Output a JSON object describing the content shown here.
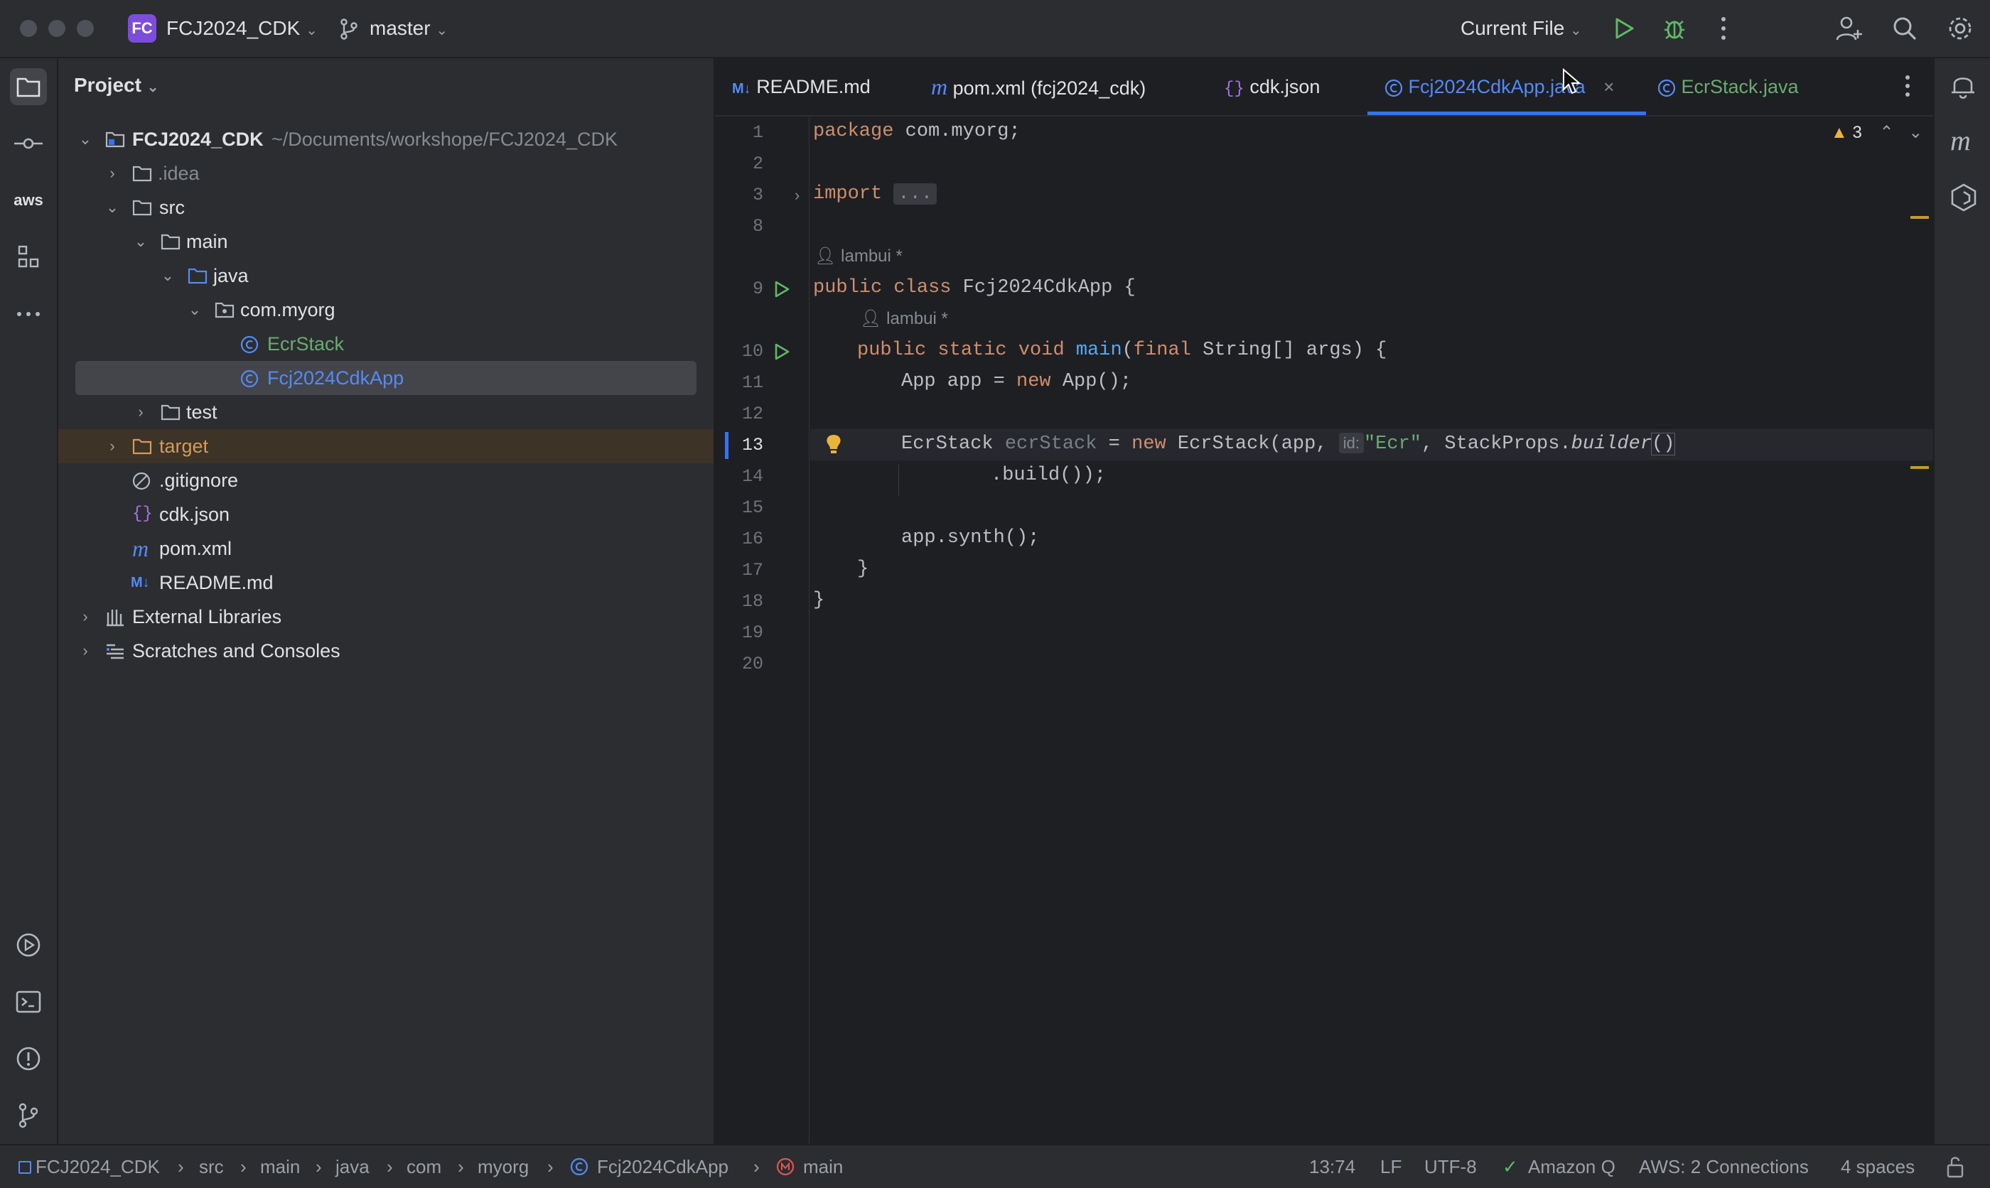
{
  "titlebar": {
    "project_badge": "FC",
    "project_name": "FCJ2024_CDK",
    "branch": "master",
    "run_config": "Current File"
  },
  "project_panel": {
    "title": "Project",
    "tree": [
      {
        "label": "FCJ2024_CDK",
        "path": "~/Documents/workshope/FCJ2024_CDK"
      },
      {
        "label": ".idea"
      },
      {
        "label": "src"
      },
      {
        "label": "main"
      },
      {
        "label": "java"
      },
      {
        "label": "com.myorg"
      },
      {
        "label": "EcrStack"
      },
      {
        "label": "Fcj2024CdkApp"
      },
      {
        "label": "test"
      },
      {
        "label": "target"
      },
      {
        "label": ".gitignore"
      },
      {
        "label": "cdk.json"
      },
      {
        "label": "pom.xml"
      },
      {
        "label": "README.md"
      },
      {
        "label": "External Libraries"
      },
      {
        "label": "Scratches and Consoles"
      }
    ]
  },
  "tabs": [
    {
      "label": "README.md",
      "icon": "M↓"
    },
    {
      "label": "pom.xml (fcj2024_cdk)",
      "icon": "m"
    },
    {
      "label": "cdk.json",
      "icon": "{}"
    },
    {
      "label": "Fcj2024CdkApp.java",
      "icon": "C"
    },
    {
      "label": "EcrStack.java",
      "icon": "C"
    }
  ],
  "editor": {
    "line_numbers": [
      "1",
      "2",
      "3",
      "8",
      "9",
      "10",
      "11",
      "12",
      "13",
      "14",
      "15",
      "16",
      "17",
      "18",
      "19",
      "20"
    ],
    "author": "lambui *",
    "warning_count": "3",
    "code": {
      "l1_kw": "package",
      "l1_rest": " com.myorg;",
      "l3_kw": "import",
      "l3_fold": "...",
      "l9_kw": "public class",
      "l9_rest": " Fcj2024CdkApp {",
      "l10_kw": "public static void",
      "l10_fn": "main",
      "l10_p1": "(",
      "l10_kw2": "final",
      "l10_rest": " String[] args) {",
      "l11_a": "App app = ",
      "l11_kw": "new",
      "l11_b": " App();",
      "l13_a": "EcrStack ",
      "l13_var": "ecrStack",
      "l13_b": " = ",
      "l13_kw": "new",
      "l13_c": " EcrStack(app, ",
      "l13_hint": "id:",
      "l13_str": "\"Ecr\"",
      "l13_d": ", StackProps.",
      "l13_it": "builder",
      "l13_e": "()",
      "l14": ".build());",
      "l16": "app.synth();",
      "l17": "}",
      "l18": "}"
    }
  },
  "statusbar": {
    "breadcrumb": [
      "FCJ2024_CDK",
      "src",
      "main",
      "java",
      "com",
      "myorg",
      "Fcj2024CdkApp",
      "main"
    ],
    "position": "13:74",
    "line_sep": "LF",
    "encoding": "UTF-8",
    "amazon_q": "Amazon Q",
    "aws": "AWS: 2 Connections",
    "indent": "4 spaces"
  }
}
